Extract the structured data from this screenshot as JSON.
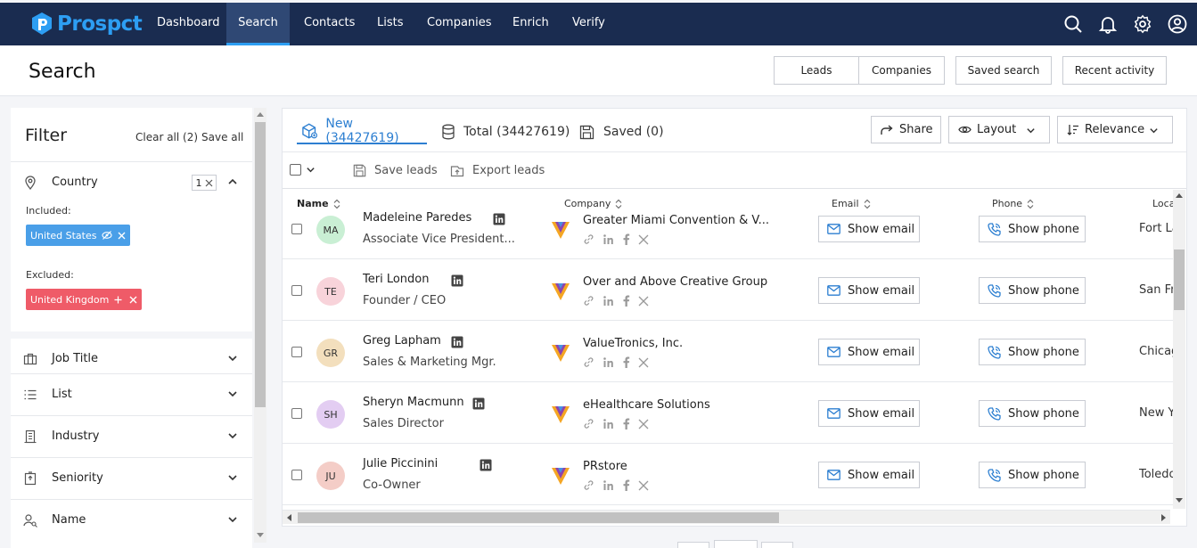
{
  "nav": {
    "brand": "Prospct",
    "items": [
      {
        "label": "Dashboard"
      },
      {
        "label": "Search"
      },
      {
        "label": "Contacts"
      },
      {
        "label": "Lists"
      },
      {
        "label": "Companies"
      },
      {
        "label": "Enrich"
      },
      {
        "label": "Verify"
      }
    ],
    "active": "Search",
    "icons": [
      "search-icon",
      "bell-icon",
      "gear-icon",
      "user-circle-icon"
    ]
  },
  "header": {
    "title": "Search",
    "segments": [
      "Leads",
      "Companies"
    ],
    "saved_search": "Saved search",
    "recent_activity": "Recent activity"
  },
  "filter": {
    "title": "Filter",
    "clear_all": "Clear all (2)",
    "save_all": "Save all",
    "country": {
      "label": "Country",
      "count": "1",
      "included_label": "Included:",
      "included_chip": "United States",
      "excluded_label": "Excluded:",
      "excluded_chip": "United Kingdom"
    },
    "sections": [
      {
        "label": "Job Title",
        "icon": "briefcase-icon"
      },
      {
        "label": "List",
        "icon": "list-icon"
      },
      {
        "label": "Industry",
        "icon": "building-icon"
      },
      {
        "label": "Seniority",
        "icon": "badge-icon"
      },
      {
        "label": "Name",
        "icon": "person-search-icon"
      }
    ]
  },
  "results": {
    "tabs": [
      {
        "label": "New (34427619)",
        "icon": "cube-icon"
      },
      {
        "label": "Total (34427619)",
        "icon": "database-icon"
      },
      {
        "label": "Saved (0)",
        "icon": "save-icon"
      }
    ],
    "share": "Share",
    "layout": "Layout",
    "sort": "Relevance",
    "save_leads": "Save leads",
    "export_leads": "Export leads",
    "columns": {
      "name": "Name",
      "company": "Company",
      "email": "Email",
      "phone": "Phone",
      "location": "Loca"
    },
    "show_email": "Show email",
    "show_phone": "Show phone",
    "rows": [
      {
        "initials": "MA",
        "avatar_color": "#c9efd4",
        "name": "Madeleine Paredes",
        "title": "Associate Vice President...",
        "company": "Greater Miami Convention & V...",
        "location": "Fort La"
      },
      {
        "initials": "TE",
        "avatar_color": "#f8d3da",
        "name": "Teri London",
        "title": "Founder / CEO",
        "company": "Over and Above Creative Group",
        "location": "San Fr"
      },
      {
        "initials": "GR",
        "avatar_color": "#f3dfbd",
        "name": "Greg Lapham",
        "title": "Sales & Marketing Mgr.",
        "company": "ValueTronics, Inc.",
        "location": "Chicag"
      },
      {
        "initials": "SH",
        "avatar_color": "#e3cdf2",
        "name": "Sheryn Macmunn",
        "title": "Sales Director",
        "company": "eHealthcare Solutions",
        "location": "New Y"
      },
      {
        "initials": "JU",
        "avatar_color": "#f4cdc7",
        "name": "Julie Piccinini",
        "title": "Co-Owner",
        "company": "PRstore",
        "location": "Toledo"
      }
    ]
  },
  "colors": {
    "navbar": "#1a2c50",
    "accent": "#2d9ef3",
    "included_chip": "#4a9fe8",
    "excluded_chip": "#ef5b68"
  }
}
